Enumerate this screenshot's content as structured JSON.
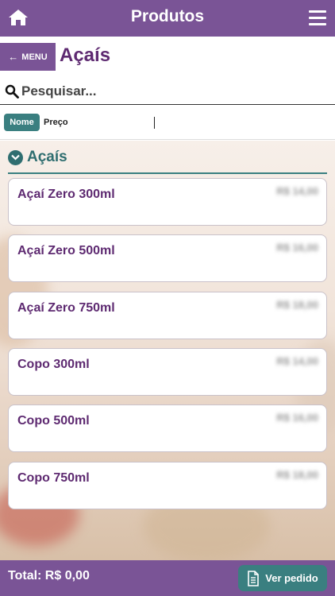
{
  "header": {
    "title": "Produtos",
    "home_icon": "home-icon",
    "menu_icon": "hamburger-icon"
  },
  "subheader": {
    "back_label": "MENU",
    "back_icon": "arrow-left-icon",
    "title": "Açaís"
  },
  "search": {
    "placeholder": "Pesquisar...",
    "icon": "search-icon"
  },
  "sort": {
    "name_label": "Nome",
    "price_label": "Preço"
  },
  "section": {
    "title": "Açaís",
    "icon": "chevron-down-circle-icon"
  },
  "products": [
    {
      "name": "Açaí Zero 300ml",
      "price": "R$ 14,00"
    },
    {
      "name": "Açaí Zero 500ml",
      "price": "R$ 16,00"
    },
    {
      "name": "Açaí Zero 750ml",
      "price": "R$ 18,00"
    },
    {
      "name": "Copo 300ml",
      "price": "R$ 14,00"
    },
    {
      "name": "Copo 500ml",
      "price": "R$ 16,00"
    },
    {
      "name": "Copo 750ml",
      "price": "R$ 18,00"
    }
  ],
  "footer": {
    "total_label": "Total: R$ 0,00",
    "order_label": "Ver pedido",
    "order_icon": "document-icon"
  },
  "colors": {
    "primary": "#7a5496",
    "accent": "#3a7f80",
    "title_text": "#5e2a71"
  }
}
